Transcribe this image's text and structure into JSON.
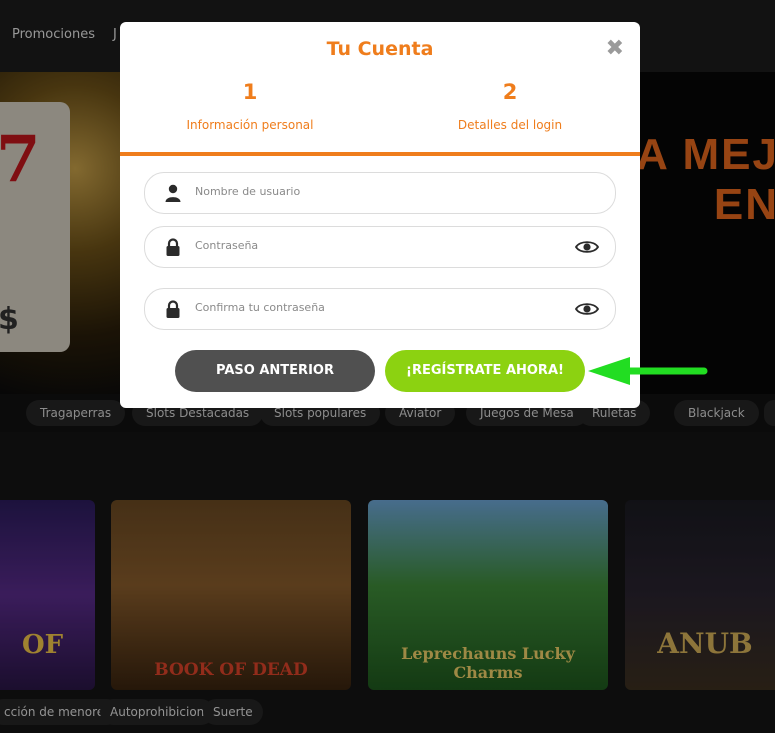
{
  "nav": {
    "links": [
      "Promociones",
      "J"
    ]
  },
  "hero": {
    "headline_line1": "A MEJ",
    "headline_line2": "EN"
  },
  "categories": [
    "Tragaperras",
    "Slots Destacadas",
    "Slots populares",
    "Aviator",
    "Juegos de Mesa",
    "Ruletas",
    "Blackjack"
  ],
  "games": [
    "OF",
    "BOOK OF DEAD",
    "Leprechauns Lucky Charms",
    "ANUB"
  ],
  "footer_links": [
    "cción de menores",
    "Autoprohibicion",
    "Suerte"
  ],
  "modal": {
    "title": "Tu Cuenta",
    "close_icon": "close-icon",
    "steps": [
      {
        "number": "1",
        "label": "Información personal"
      },
      {
        "number": "2",
        "label": "Detalles del login"
      }
    ],
    "fields": [
      {
        "placeholder": "Nombre de usuario",
        "icon": "user-icon"
      },
      {
        "placeholder": "Contraseña",
        "icon": "lock-icon",
        "toggle_icon": "eye-icon"
      },
      {
        "placeholder": "Confirma tu contraseña",
        "icon": "lock-icon",
        "toggle_icon": "eye-icon"
      }
    ],
    "buttons": {
      "back": "PASO ANTERIOR",
      "register": "¡REGÍSTRATE AHORA!"
    }
  },
  "colors": {
    "accent": "#ef7d1c",
    "register_button": "#8cd211",
    "back_button": "#505050",
    "annotation_arrow": "#22dd22"
  }
}
